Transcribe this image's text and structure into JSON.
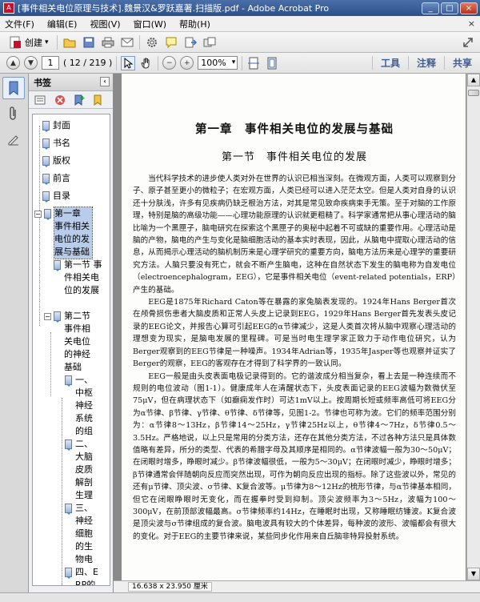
{
  "window": {
    "title": "[事件相关电位原理与技术].魏景汉&罗跃嘉著.扫描版.pdf - Adobe Acrobat Pro",
    "app_icon": "acrobat-icon"
  },
  "menu": {
    "items": [
      "文件(F)",
      "编辑(E)",
      "视图(V)",
      "窗口(W)",
      "帮助(H)"
    ],
    "close": "×"
  },
  "toolbar": {
    "create_label": "创建",
    "icons": [
      "open-folder-icon",
      "save-icon",
      "print-icon",
      "email-icon",
      "settings-icon",
      "comment-icon",
      "export-icon",
      "share-icon",
      "expand-icon"
    ]
  },
  "navbar": {
    "page_input": "1",
    "page_count": "( 12 / 219 )",
    "zoom": "100%",
    "tools_label": "工具",
    "comment_label": "注释",
    "share_label": "共享"
  },
  "bookmarks": {
    "header": "书签",
    "items": [
      {
        "label": "封面",
        "level": 0
      },
      {
        "label": "书名",
        "level": 0
      },
      {
        "label": "版权",
        "level": 0
      },
      {
        "label": "前言",
        "level": 0
      },
      {
        "label": "目录",
        "level": 0
      },
      {
        "label": "第一章 事件相关电位的发展与基础",
        "level": 0,
        "selected": true,
        "expanded": true
      },
      {
        "label": "第一节 事件相关电位的发展",
        "level": 1
      },
      {
        "label": "第二节 事件相关电位的神经基础",
        "level": 1,
        "expanded": true
      },
      {
        "label": "一、中枢神经系统的组",
        "level": 2
      },
      {
        "label": "二、大脑皮质解剖生理",
        "level": 2
      },
      {
        "label": "三、神经细胞的生物电",
        "level": 2
      },
      {
        "label": "四、ERP的形成原理",
        "level": 2
      }
    ]
  },
  "document": {
    "chapter_title": "第一章　事件相关电位的发展与基础",
    "section_title": "第一节　事件相关电位的发展",
    "paragraphs": [
      "当代科学技术的进步使人类对外在世界的认识已相当深刻。在微观方面，人类可以观察到分子、原子甚至更小的微粒子；在宏观方面，人类已经可以进入茫茫太空。但是人类对自身的认识还十分肤浅，许多有见疾病仍缺乏根治方法，对其是常见致命疾病束手无策。至于对脑的工作原理，特别是脑的高级功能——心理功能原理的认识就更粗糙了。科学家通常把从事心理活动的脑比喻为一个黑匣子，脑电研究在探索这个黑匣子的奥秘中起着不可或缺的重要作用。心理活动是脑的产物，脑电的产生与变化是脑细胞活动的基本实时表现，因此，从脑电中提取心理活动的信息，从而揭示心理活动的脑机制历来是心理学研究的重要方向，脑电方法历来是心理学的重要研究方法。人脑只要没有死亡，就会不断产生脑电，这种在自然状态下发生的脑电称为自发电位（electroencephalogram，EEG），它是事件相关电位（event-related potentials，ERP）产生的基础。",
      "EEG是1875年Richard Caton等在暴露的家兔脑表发现的。1924年Hans Berger首次在颅骨损伤患者大脑皮质和正常人头皮上记录到EEG，1929年Hans Berger首先发表头皮记录的EEG论文，并报告心算可引起EEG的α节律减少，这是人类首次将从脑中观察心理活动的理想变为现实，是脑电发展的里程碑。可是当时电生理学家正致力于动作电位研究，认为Berger观察到的EEG节律是一种噪声。1934年Adrian等，1935年Jasper等也观察并证实了Berger的观察，EEG的客观存在才得到了科学界的一致认同。",
      "EEG一般是由头皮表面电极记录得到的。它的谐波成分相当复杂，看上去是一种连续而不规则的电位波动（图1-1）。健康成年人在清醒状态下，头皮表面记录的EEG波幅为数微伏至75μV，但在病理状态下（如癫痫发作时）可达1mV以上。按周期长短或频率高低可将EEG分为α节律、β节律、γ节律、θ节律、δ节律等，见图1-2。节律也可称为波。它们的频率范围分别为：α节律8～13Hz，β节律14～25Hz，γ节律25Hz以上，θ节律4～7Hz，δ节律0.5～3.5Hz。严格地说，以上只是常用的分类方法，还存在其他分类方法，不过各种方法只是具体数值略有差异，所分的类型、代表的希腊字母及其顺序是相同的。α节律波幅一般为30～50μV；在闭眼时增多，睁眼时减少。β节律波幅很低，一般为5～30μV；在闭眼时减少，睁眼时增多；β节律通常会伴随朝向反应而突然出现，可作为朝向反应出现的指标。除了这些波以外，常见的还有μ节律、顶尖波、σ节律、K复合波等。μ节律为8～12Hz的梳形节律，与α节律基本相同，但它在闭眼睁眼时无变化，而在握拳时受到抑制。顶尖波频率为3～5Hz，波幅为100～300μV，在前顶部波幅最高。σ节律频率约14Hz，在睡眠时出现，又称睡眠纺锤波。K复合波是顶尖波与σ节律组成的复合波。脑电波具有较大的个体差异，每种波的波形、波幅都会有很大的变化。对于EEG的主要节律来说，某些同步化作用来自丘脑非特异投射系统。"
    ]
  },
  "status": {
    "page_dims": "16.638 x 23.950 厘米"
  }
}
